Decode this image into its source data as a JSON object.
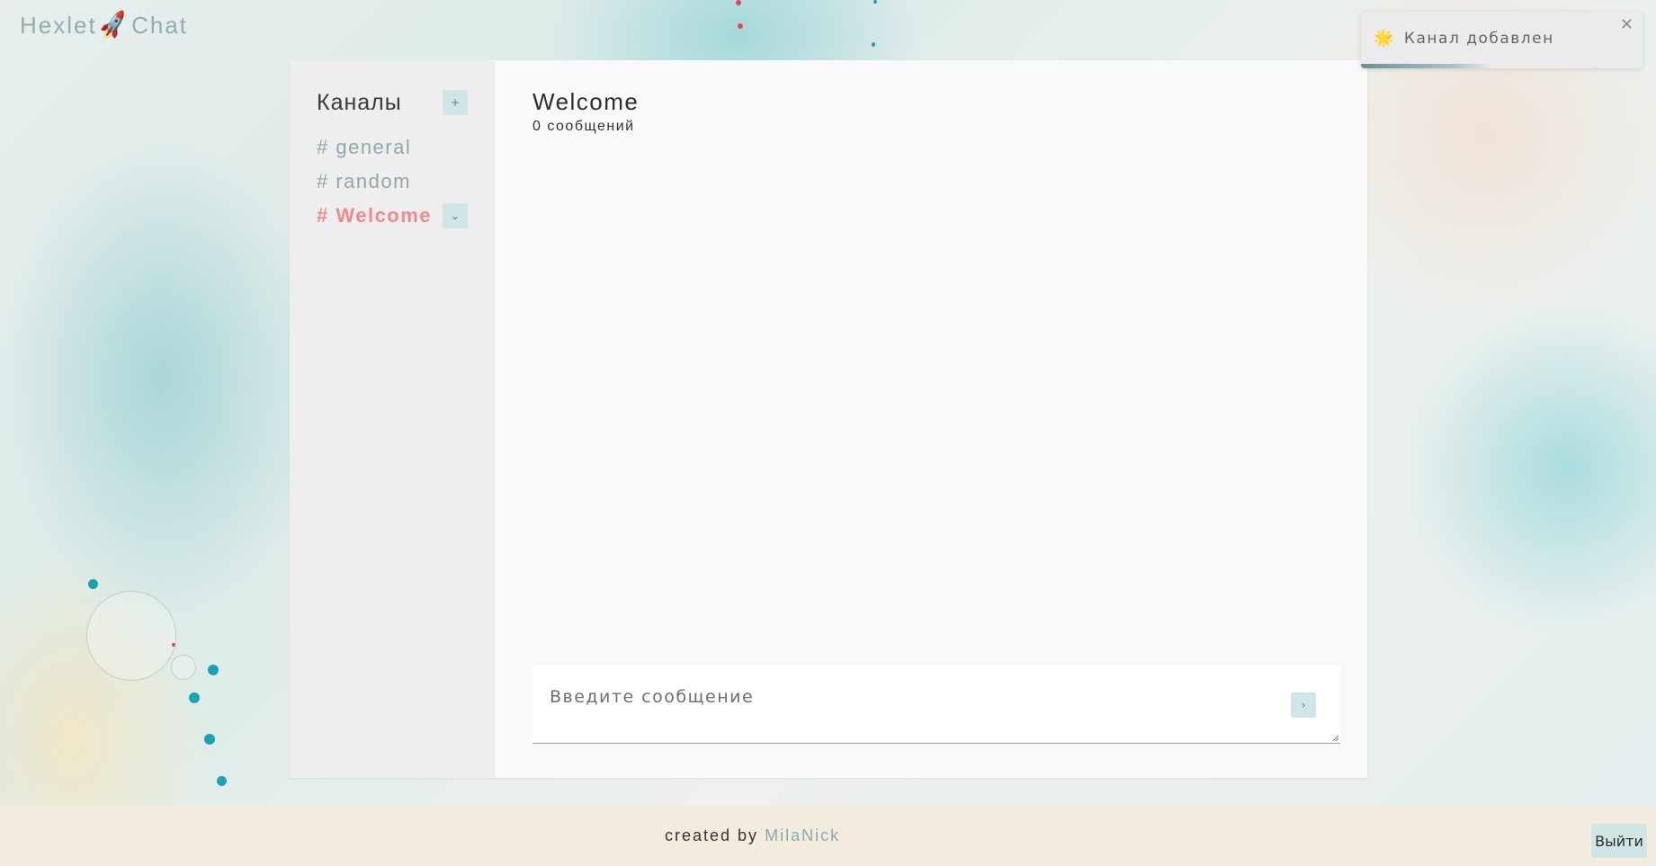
{
  "brand": {
    "left": "Hexlet",
    "icon": "rocket-icon",
    "glyph": "🚀",
    "right": "Chat"
  },
  "sidebar": {
    "title": "Каналы",
    "add_label": "+",
    "channels": [
      {
        "label": "# general",
        "active": false
      },
      {
        "label": "# random",
        "active": false
      },
      {
        "label": "# Welcome",
        "active": true,
        "menu_label": "⌄"
      }
    ]
  },
  "main": {
    "channel_title": "Welcome",
    "message_count": "0 сообщений",
    "input_placeholder": "Введите сообщение",
    "send_label": "›"
  },
  "toast": {
    "icon": "sun-icon",
    "icon_glyph": "🌟",
    "text": "Канал добавлен",
    "close": "✕",
    "progress": 0.47
  },
  "footer": {
    "prefix": "created by",
    "author": "MilaNick"
  },
  "logout_label": "Выйти",
  "colors": {
    "accent": "#cfe5e6",
    "active_channel": "#ef8a8a",
    "muted_channel": "#93a6a8",
    "footer_bg": "#f4ebdf",
    "link": "#86abab"
  }
}
